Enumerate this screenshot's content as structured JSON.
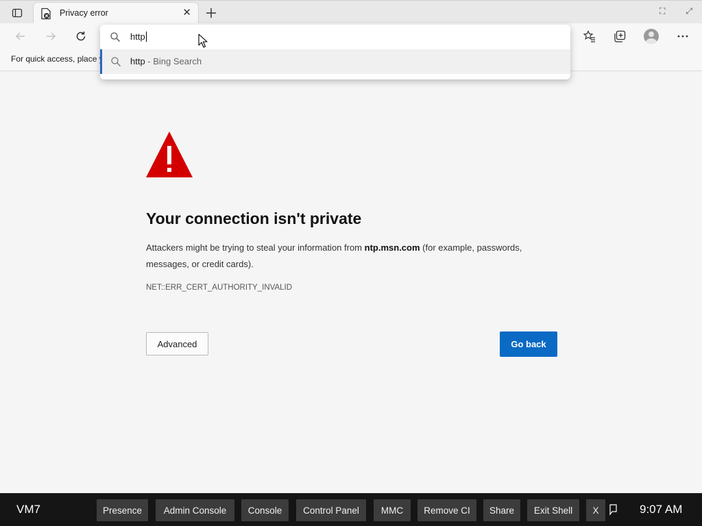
{
  "browser": {
    "tab": {
      "title": "Privacy error",
      "close_glyph": "✕"
    },
    "window_controls": [
      "⛶",
      "⤢"
    ],
    "favorites_bar_text": "For quick access, place y",
    "omnibox": {
      "input_value": "http",
      "suggestion": {
        "query": "http",
        "separator": " - ",
        "engine": "Bing Search"
      }
    }
  },
  "error_page": {
    "heading": "Your connection isn't private",
    "description_before": "Attackers might be trying to steal your information from ",
    "host": "ntp.msn.com",
    "description_after": " (for example, passwords, messages, or credit cards).",
    "error_code": "NET::ERR_CERT_AUTHORITY_INVALID",
    "advanced_label": "Advanced",
    "go_back_label": "Go back"
  },
  "taskbar": {
    "vm_name": "VM7",
    "buttons": [
      "Presence",
      "Admin Console",
      "Console",
      "Control Panel",
      "MMC",
      "Remove CI",
      "Share",
      "Exit Shell",
      "X"
    ],
    "clock": "9:07 AM"
  },
  "colors": {
    "accent": "#0a6ac4",
    "warning_red": "#d40000",
    "suggestion_highlight": "#2b66c4",
    "taskbar_bg": "#151515",
    "taskbar_button": "#3c3c3c"
  },
  "icons": [
    "tab-actions-icon",
    "error-favicon-icon",
    "close-icon",
    "plus-icon",
    "back-arrow-icon",
    "forward-arrow-icon",
    "refresh-icon",
    "search-icon",
    "favorites-star-icon",
    "collections-icon",
    "profile-avatar-icon",
    "more-icon",
    "warning-triangle-icon",
    "mouse-cursor-icon",
    "notification-icon"
  ]
}
